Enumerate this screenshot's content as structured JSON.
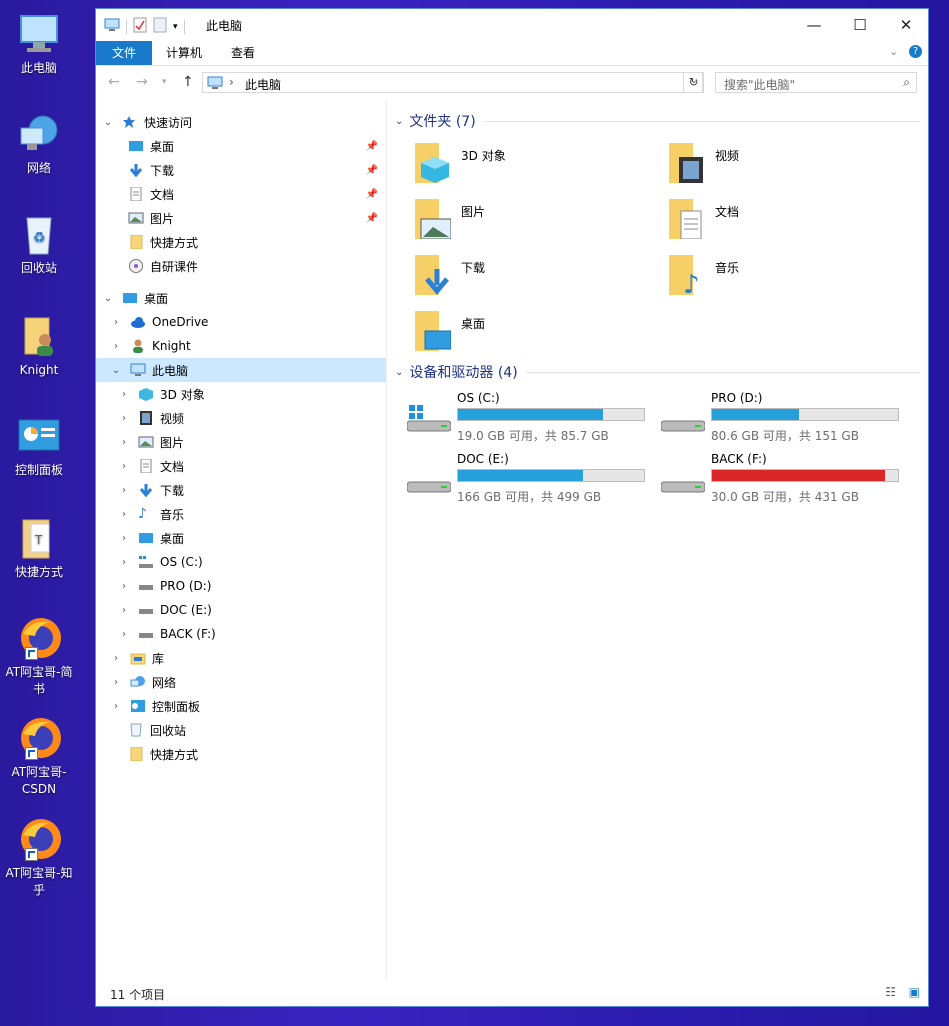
{
  "desktop": {
    "icons": [
      {
        "label": "此电脑"
      },
      {
        "label": "网络"
      },
      {
        "label": "回收站"
      },
      {
        "label": "Knight"
      },
      {
        "label": "控制面板"
      },
      {
        "label": "快捷方式"
      },
      {
        "label": "AT阿宝哥-简书"
      },
      {
        "label": "AT阿宝哥-CSDN"
      },
      {
        "label": "AT阿宝哥-知乎"
      }
    ]
  },
  "window": {
    "title": "此电脑",
    "controls": {
      "minimize": "—",
      "maximize": "☐",
      "close": "✕"
    },
    "ribbon_tabs": [
      "文件",
      "计算机",
      "查看"
    ],
    "address": {
      "path": "此电脑"
    },
    "search": {
      "placeholder": "搜索\"此电脑\""
    }
  },
  "nav": {
    "quick_access": "快速访问",
    "quick_items": [
      "桌面",
      "下载",
      "文档",
      "图片",
      "快捷方式",
      "自研课件"
    ],
    "desktop": "桌面",
    "desktop_children": [
      "OneDrive",
      "Knight",
      "此电脑"
    ],
    "pc_children": [
      "3D 对象",
      "视频",
      "图片",
      "文档",
      "下载",
      "音乐",
      "桌面",
      "OS (C:)",
      "PRO (D:)",
      "DOC (E:)",
      "BACK (F:)"
    ],
    "tail": [
      "库",
      "网络",
      "控制面板",
      "回收站",
      "快捷方式"
    ]
  },
  "content": {
    "folders_header": "文件夹 (7)",
    "folders": [
      "3D 对象",
      "视频",
      "图片",
      "文档",
      "下载",
      "音乐",
      "桌面"
    ],
    "drives_header": "设备和驱动器 (4)",
    "drives": [
      {
        "name": "OS (C:)",
        "free": "19.0 GB 可用，共 85.7 GB",
        "used_fraction": 0.78,
        "color": "#26a0da"
      },
      {
        "name": "PRO (D:)",
        "free": "80.6 GB 可用，共 151 GB",
        "used_fraction": 0.47,
        "color": "#26a0da"
      },
      {
        "name": "DOC (E:)",
        "free": "166 GB 可用，共 499 GB",
        "used_fraction": 0.67,
        "color": "#26a0da"
      },
      {
        "name": "BACK (F:)",
        "free": "30.0 GB 可用，共 431 GB",
        "used_fraction": 0.93,
        "color": "#da2626"
      }
    ]
  },
  "status": {
    "count": "11 个项目"
  }
}
